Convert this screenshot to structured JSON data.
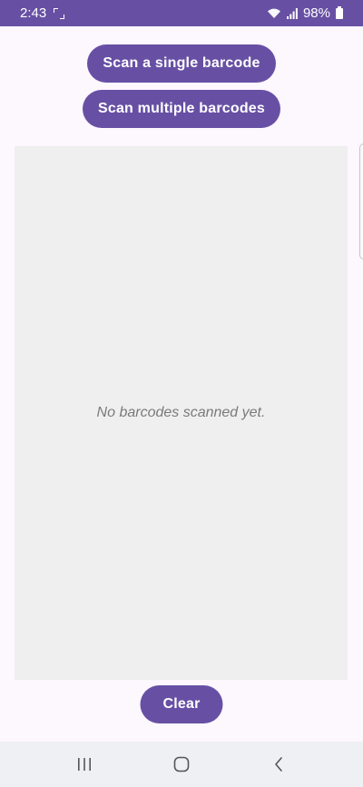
{
  "status_bar": {
    "time": "2:43",
    "battery": "98%",
    "icons": [
      "screenshot-icon",
      "wifi-icon",
      "signal-icon",
      "battery-icon"
    ]
  },
  "actions": {
    "scan_single_label": "Scan a single barcode",
    "scan_multiple_label": "Scan multiple barcodes",
    "clear_label": "Clear"
  },
  "results": {
    "empty_message": "No barcodes scanned yet."
  },
  "nav_bar": {
    "icons": [
      "recent-apps-icon",
      "home-icon",
      "back-icon"
    ]
  },
  "colors": {
    "primary": "#6750a4",
    "background": "#fdf7fe",
    "panel": "#efefef"
  }
}
